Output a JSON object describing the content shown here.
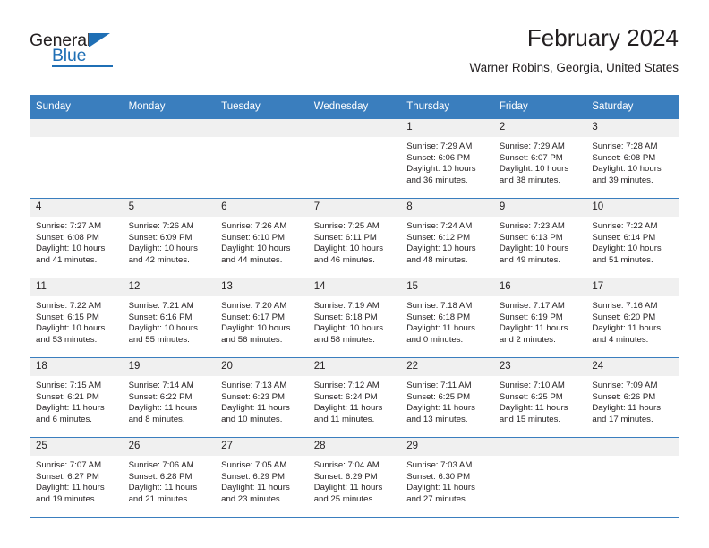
{
  "brand": {
    "word_one": "General",
    "word_two": "Blue",
    "triangle_icon": "blue-triangle-icon",
    "accent_color": "#1f6fb5"
  },
  "header": {
    "title": "February 2024",
    "subtitle": "Warner Robins, Georgia, United States"
  },
  "theme": {
    "header_blue": "#3a7ebe",
    "daynum_background": "#f0f0f0",
    "text_color": "#231f20"
  },
  "weekday_headers": [
    "Sunday",
    "Monday",
    "Tuesday",
    "Wednesday",
    "Thursday",
    "Friday",
    "Saturday"
  ],
  "weeks": [
    [
      {
        "day": "",
        "empty": true
      },
      {
        "day": "",
        "empty": true
      },
      {
        "day": "",
        "empty": true
      },
      {
        "day": "",
        "empty": true
      },
      {
        "day": "1",
        "sunrise": "Sunrise: 7:29 AM",
        "sunset": "Sunset: 6:06 PM",
        "daylight_line1": "Daylight: 10 hours",
        "daylight_line2": "and 36 minutes."
      },
      {
        "day": "2",
        "sunrise": "Sunrise: 7:29 AM",
        "sunset": "Sunset: 6:07 PM",
        "daylight_line1": "Daylight: 10 hours",
        "daylight_line2": "and 38 minutes."
      },
      {
        "day": "3",
        "sunrise": "Sunrise: 7:28 AM",
        "sunset": "Sunset: 6:08 PM",
        "daylight_line1": "Daylight: 10 hours",
        "daylight_line2": "and 39 minutes."
      }
    ],
    [
      {
        "day": "4",
        "sunrise": "Sunrise: 7:27 AM",
        "sunset": "Sunset: 6:08 PM",
        "daylight_line1": "Daylight: 10 hours",
        "daylight_line2": "and 41 minutes."
      },
      {
        "day": "5",
        "sunrise": "Sunrise: 7:26 AM",
        "sunset": "Sunset: 6:09 PM",
        "daylight_line1": "Daylight: 10 hours",
        "daylight_line2": "and 42 minutes."
      },
      {
        "day": "6",
        "sunrise": "Sunrise: 7:26 AM",
        "sunset": "Sunset: 6:10 PM",
        "daylight_line1": "Daylight: 10 hours",
        "daylight_line2": "and 44 minutes."
      },
      {
        "day": "7",
        "sunrise": "Sunrise: 7:25 AM",
        "sunset": "Sunset: 6:11 PM",
        "daylight_line1": "Daylight: 10 hours",
        "daylight_line2": "and 46 minutes."
      },
      {
        "day": "8",
        "sunrise": "Sunrise: 7:24 AM",
        "sunset": "Sunset: 6:12 PM",
        "daylight_line1": "Daylight: 10 hours",
        "daylight_line2": "and 48 minutes."
      },
      {
        "day": "9",
        "sunrise": "Sunrise: 7:23 AM",
        "sunset": "Sunset: 6:13 PM",
        "daylight_line1": "Daylight: 10 hours",
        "daylight_line2": "and 49 minutes."
      },
      {
        "day": "10",
        "sunrise": "Sunrise: 7:22 AM",
        "sunset": "Sunset: 6:14 PM",
        "daylight_line1": "Daylight: 10 hours",
        "daylight_line2": "and 51 minutes."
      }
    ],
    [
      {
        "day": "11",
        "sunrise": "Sunrise: 7:22 AM",
        "sunset": "Sunset: 6:15 PM",
        "daylight_line1": "Daylight: 10 hours",
        "daylight_line2": "and 53 minutes."
      },
      {
        "day": "12",
        "sunrise": "Sunrise: 7:21 AM",
        "sunset": "Sunset: 6:16 PM",
        "daylight_line1": "Daylight: 10 hours",
        "daylight_line2": "and 55 minutes."
      },
      {
        "day": "13",
        "sunrise": "Sunrise: 7:20 AM",
        "sunset": "Sunset: 6:17 PM",
        "daylight_line1": "Daylight: 10 hours",
        "daylight_line2": "and 56 minutes."
      },
      {
        "day": "14",
        "sunrise": "Sunrise: 7:19 AM",
        "sunset": "Sunset: 6:18 PM",
        "daylight_line1": "Daylight: 10 hours",
        "daylight_line2": "and 58 minutes."
      },
      {
        "day": "15",
        "sunrise": "Sunrise: 7:18 AM",
        "sunset": "Sunset: 6:18 PM",
        "daylight_line1": "Daylight: 11 hours",
        "daylight_line2": "and 0 minutes."
      },
      {
        "day": "16",
        "sunrise": "Sunrise: 7:17 AM",
        "sunset": "Sunset: 6:19 PM",
        "daylight_line1": "Daylight: 11 hours",
        "daylight_line2": "and 2 minutes."
      },
      {
        "day": "17",
        "sunrise": "Sunrise: 7:16 AM",
        "sunset": "Sunset: 6:20 PM",
        "daylight_line1": "Daylight: 11 hours",
        "daylight_line2": "and 4 minutes."
      }
    ],
    [
      {
        "day": "18",
        "sunrise": "Sunrise: 7:15 AM",
        "sunset": "Sunset: 6:21 PM",
        "daylight_line1": "Daylight: 11 hours",
        "daylight_line2": "and 6 minutes."
      },
      {
        "day": "19",
        "sunrise": "Sunrise: 7:14 AM",
        "sunset": "Sunset: 6:22 PM",
        "daylight_line1": "Daylight: 11 hours",
        "daylight_line2": "and 8 minutes."
      },
      {
        "day": "20",
        "sunrise": "Sunrise: 7:13 AM",
        "sunset": "Sunset: 6:23 PM",
        "daylight_line1": "Daylight: 11 hours",
        "daylight_line2": "and 10 minutes."
      },
      {
        "day": "21",
        "sunrise": "Sunrise: 7:12 AM",
        "sunset": "Sunset: 6:24 PM",
        "daylight_line1": "Daylight: 11 hours",
        "daylight_line2": "and 11 minutes."
      },
      {
        "day": "22",
        "sunrise": "Sunrise: 7:11 AM",
        "sunset": "Sunset: 6:25 PM",
        "daylight_line1": "Daylight: 11 hours",
        "daylight_line2": "and 13 minutes."
      },
      {
        "day": "23",
        "sunrise": "Sunrise: 7:10 AM",
        "sunset": "Sunset: 6:25 PM",
        "daylight_line1": "Daylight: 11 hours",
        "daylight_line2": "and 15 minutes."
      },
      {
        "day": "24",
        "sunrise": "Sunrise: 7:09 AM",
        "sunset": "Sunset: 6:26 PM",
        "daylight_line1": "Daylight: 11 hours",
        "daylight_line2": "and 17 minutes."
      }
    ],
    [
      {
        "day": "25",
        "sunrise": "Sunrise: 7:07 AM",
        "sunset": "Sunset: 6:27 PM",
        "daylight_line1": "Daylight: 11 hours",
        "daylight_line2": "and 19 minutes."
      },
      {
        "day": "26",
        "sunrise": "Sunrise: 7:06 AM",
        "sunset": "Sunset: 6:28 PM",
        "daylight_line1": "Daylight: 11 hours",
        "daylight_line2": "and 21 minutes."
      },
      {
        "day": "27",
        "sunrise": "Sunrise: 7:05 AM",
        "sunset": "Sunset: 6:29 PM",
        "daylight_line1": "Daylight: 11 hours",
        "daylight_line2": "and 23 minutes."
      },
      {
        "day": "28",
        "sunrise": "Sunrise: 7:04 AM",
        "sunset": "Sunset: 6:29 PM",
        "daylight_line1": "Daylight: 11 hours",
        "daylight_line2": "and 25 minutes."
      },
      {
        "day": "29",
        "sunrise": "Sunrise: 7:03 AM",
        "sunset": "Sunset: 6:30 PM",
        "daylight_line1": "Daylight: 11 hours",
        "daylight_line2": "and 27 minutes."
      },
      {
        "day": "",
        "empty": true
      },
      {
        "day": "",
        "empty": true
      }
    ]
  ]
}
